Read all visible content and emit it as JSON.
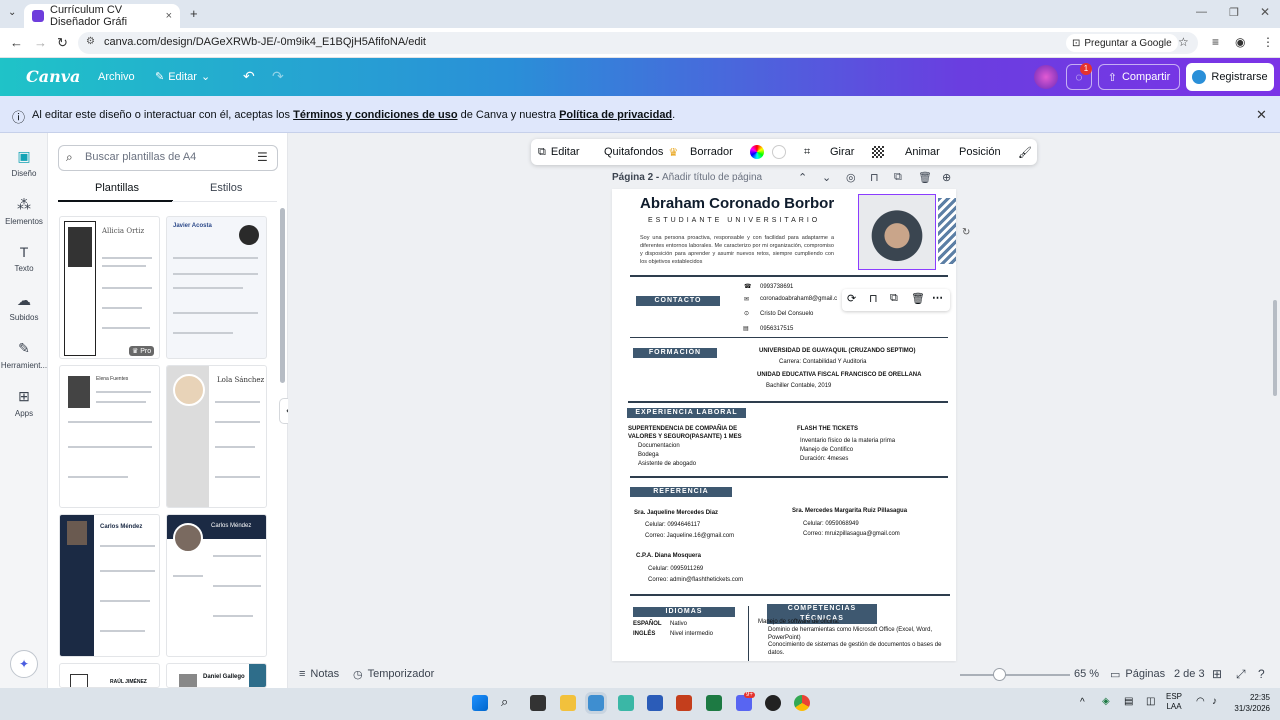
{
  "browser": {
    "tab_title": "Currículum CV Diseñador Gráfi",
    "url": "canva.com/design/DAGeXRWb-JE/-0m9ik4_E1BQjH5AfifoNA/edit",
    "ask_google": "Preguntar a Google"
  },
  "canva": {
    "logo": "Canva",
    "menu_archivo": "Archivo",
    "menu_editar": "Editar",
    "notif_count": "1",
    "share": "Compartir",
    "register": "Registrarse"
  },
  "notice": {
    "prefix": "Al editar este diseño o interactuar con él, aceptas los ",
    "terms": "Términos y condiciones de uso",
    "middle": " de Canva y nuestra ",
    "privacy": "Política de privacidad",
    "suffix": "."
  },
  "leftnav": {
    "diseno": "Diseño",
    "elementos": "Elementos",
    "texto": "Texto",
    "subidos": "Subidos",
    "herramientas": "Herramient...",
    "apps": "Apps"
  },
  "panel": {
    "search_placeholder": "Buscar plantillas de A4",
    "tab_plantillas": "Plantillas",
    "tab_estilos": "Estilos",
    "pro_badge": "Pro",
    "templates": [
      "Allicia Ortiz",
      "Javier Acosta",
      "Elena Fuentes",
      "Lola Sánchez",
      "Carlos Méndez",
      "Carlos Méndez",
      "RAÚL JIMÉNEZ",
      "Daniel Gallego"
    ]
  },
  "toolbar": {
    "editar": "Editar",
    "quitafondos": "Quitafondos",
    "borrador": "Borrador",
    "girar": "Girar",
    "animar": "Animar",
    "posicion": "Posición"
  },
  "pageheader": {
    "label": "Página 2 - ",
    "placeholder": "Añadir título de página"
  },
  "resume": {
    "name": "Abraham Coronado Borbor",
    "subtitle": "ESTUDIANTE UNIVERSITARIO",
    "summary": "Soy una persona proactiva, responsable y con facilidad para adaptarme a diferentes entornos laborales. Me caracterizo por mi organización, compromiso y disposición para aprender y asumir nuevos retos, siempre cumpliendo con los objetivos establecidos",
    "contacto": "CONTACTO",
    "phone": "0993738691",
    "email": "coronadoabraham8@gmail.c",
    "address": "Cristo Del Consuelo",
    "id": "0956317515",
    "formacion": "FORMACIÓN",
    "edu1": "UNIVERSIDAD DE GUAYAQUIL (CRUZANDO SEPTIMO)",
    "edu1b": "Carrera: Contabilidad Y Auditoria",
    "edu2": "UNIDAD EDUCATIVA FISCAL FRANCISCO DE ORELLANA",
    "edu2b": "Bachiller Contable, 2019",
    "experiencia": "EXPERIENCIA LABORAL",
    "exp1": "SUPERTENDENCIA DE COMPAÑIA DE VALORES Y SEGURO(PASANTE) 1 MES",
    "exp1items": [
      "Documentacion",
      "Bodega",
      "Asistente de abogado"
    ],
    "exp2": "FLASH THE TICKETS",
    "exp2items": [
      "Inventario físico de la materia prima",
      "Manejo de Contifico",
      "Duración: 4meses"
    ],
    "referencia": "REFERENCIA",
    "ref1": "Sra.  Jaqueline Mercedes Diaz",
    "ref1cel": "Celular: 0994646117",
    "ref1mail": "Correo: Jaqueline.16@gmail.com",
    "ref2": "Sra.  Mercedes Margarita Ruiz Pillasagua",
    "ref2cel": "Celular: 0959068949",
    "ref2mail": "Correo: mruizpillasagua@gmail.com",
    "ref3": "C.P.A. Diana Mosquera",
    "ref3cel": "Celular: 0995911269",
    "ref3mail": "Correo: admin@flashthetickets.com",
    "idiomas": "IDIOMAS",
    "lang1": "ESPAÑOL",
    "lang1v": "Nativo",
    "lang2": "INGLÉS",
    "lang2v": "Nivel intermedio",
    "competencias": "COMPETENCIAS TÉCNICAS",
    "comp0": "Manejo de software de oficina:",
    "comp1": "Dominio de herramientas como Microsoft Office (Excel, Word, PowerPoint)",
    "comp2": "Conocimiento de sistemas de gestión de documentos o bases de datos."
  },
  "bottom": {
    "notas": "Notas",
    "temporizador": "Temporizador",
    "zoom": "65 %",
    "zoom_value": 0.65,
    "paginas": "Páginas",
    "pagecount": "2 de 3"
  },
  "taskbar": {
    "lang1": "ESP",
    "lang2": "LAA",
    "time": "22:35",
    "date": "31/3/2026",
    "badge": "9+"
  }
}
